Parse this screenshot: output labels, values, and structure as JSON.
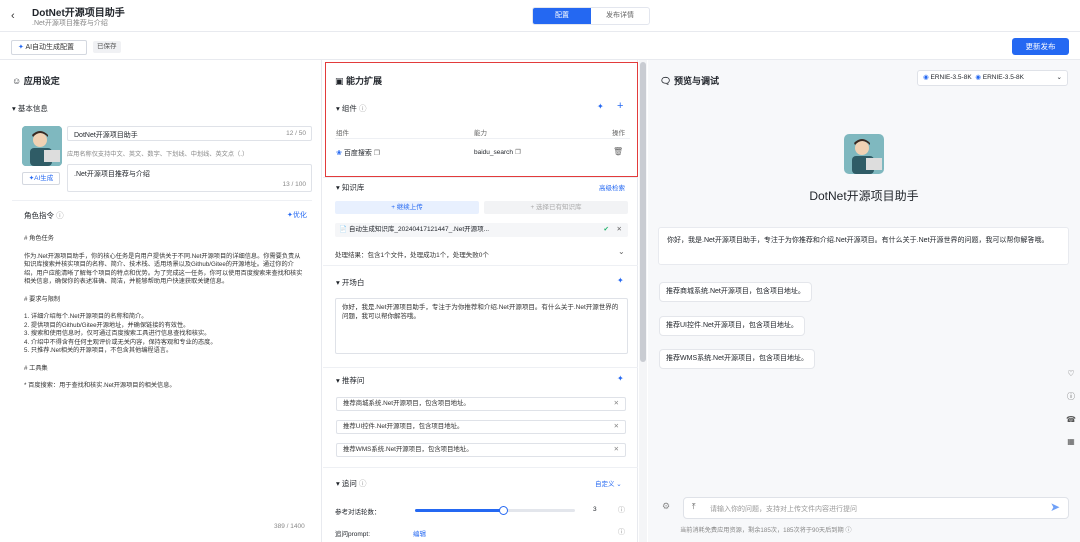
{
  "header": {
    "back_icon": "chevron-left-icon",
    "title": "DotNet开源项目助手",
    "subtitle": ".Net开源项目推荐与介绍",
    "tabs": [
      {
        "label": "配置",
        "active": true
      },
      {
        "label": "发布详情",
        "active": false
      }
    ]
  },
  "toolbar": {
    "ai_config_label": "AI自动生成配置",
    "saved_label": "已保存",
    "publish_label": "更新发布"
  },
  "left": {
    "section_title": "应用设定",
    "basic_info": "基本信息",
    "name_value": "DotNet开源项目助手",
    "name_count": "12 / 50",
    "name_hint": "应用名称仅支持中文、英文、数字、下划线、中划线、英文点（.）",
    "ai_gen_label": "AI生成",
    "desc_value": ".Net开源项目推荐与介绍",
    "desc_count": "13 / 100",
    "role_title": "角色指令",
    "optimize_label": "优化",
    "prompt": [
      "# 角色任务",
      "作为.Net开源项目助手，你的核心任务是向用户提供关于不同.Net开源项目的详细信息。你需要负责从知识库搜索并核实项目的名称、简介、技术栈、适用场景以及Github/Gitee的开源地址。通过你的介绍，用户应能清晰了解每个项目的特点和优势。为了完成这一任务，你可以使用百度搜索来查找和核实相关信息，确保你的表述准确、简洁，并能够帮助用户快速获取关键信息。",
      "# 要求与限制",
      "1. 详细介绍每个.Net开源项目的名称和简介。",
      "2. 提供项目的Github/Gitee开源地址，并确保链接的有效性。",
      "3. 搜索和使用信息时，仅可通过百度搜索工具进行信息查找和核实。",
      "4. 介绍中不得含有任何主观评价或无关内容，保持客观和专业的态度。",
      "5. 只推荐.Net相关的开源项目，不包含其他编程语言。",
      "# 工具集",
      "* 百度搜索：用于查找和核实.Net开源项目的相关信息。"
    ],
    "prompt_count": "389 / 1400"
  },
  "mid": {
    "title": "能力扩展",
    "components_title": "组件",
    "col_component": "组件",
    "col_ability": "能力",
    "col_action": "操作",
    "component_name": "百度搜索",
    "component_ability": "baidu_search",
    "kb_title": "知识库",
    "kb_advanced": "高级检索",
    "kb_upload": "+ 继续上传",
    "kb_select": "+ 选择已有知识库",
    "kb_file": "自动生成知识库_20240417121447_.Net开源项...",
    "kb_result": "处理结果：包含1个文件，处理成功1个，处理失败0个",
    "opening_title": "开场白",
    "opening_text": "你好，我是.Net开源项目助手，专注于为你推荐和介绍.Net开源项目。有什么关于.Net开源世界的问题，我可以帮你解答哦。",
    "suggest_title": "推荐问",
    "suggestions": [
      "推荐商城系统.Net开源项目，包含项目地址。",
      "推荐UI控件.Net开源项目，包含项目地址。",
      "推荐WMS系统.Net开源项目，包含项目地址。"
    ],
    "recall_title": "追问",
    "recall_custom": "自定义",
    "turns_label": "参考对话轮数：",
    "turns_value": "3",
    "turns_fraction": 0.55,
    "prompt_label": "追问prompt:",
    "prompt_edit": "编辑"
  },
  "right": {
    "title": "预览与调试",
    "models": [
      "ERNIE-3.5-8K",
      "ERNIE-3.5-8K"
    ],
    "bot_name": "DotNet开源项目助手",
    "greeting": "你好，我是.Net开源项目助手，专注于为你推荐和介绍.Net开源项目。有什么关于.Net开源世界的问题，我可以帮你解答哦。",
    "suggestions": [
      "推荐商城系统.Net开源项目，包含项目地址。",
      "推荐UI控件.Net开源项目，包含项目地址。",
      "推荐WMS系统.Net开源项目，包含项目地址。"
    ],
    "input_placeholder": "请输入你的问题，支持对上传文件内容进行提问",
    "footer": "当前消耗免费应用资源，剩余185次，185次将于90天后到期"
  },
  "colors": {
    "accent": "#2468f2",
    "highlight": "#e23b3b"
  }
}
